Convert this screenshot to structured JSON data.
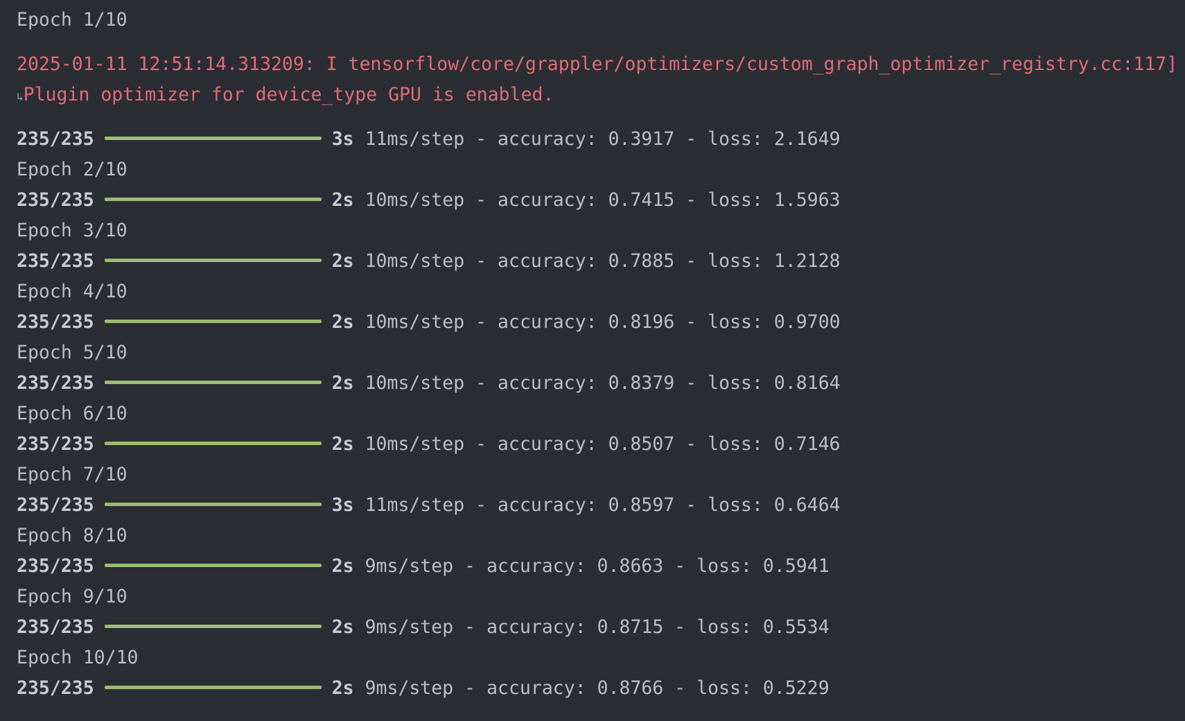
{
  "console": {
    "warning": {
      "line1": "2025-01-11 12:51:14.313209: I tensorflow/core/grappler/optimizers/custom_graph_optimizer_registry.cc:117]",
      "line2": "Plugin optimizer for device_type GPU is enabled.",
      "wrap_icon_start": "wrap-arrow-icon",
      "wrap_icon_end": "wrap-continue-icon"
    },
    "progress_color": "#9bbd72",
    "error_color": "#e06c75",
    "epochs": [
      {
        "label": "Epoch 1/10",
        "steps": "235/235",
        "progress": 1.0,
        "duration": "3s",
        "stats": "11ms/step - accuracy: 0.3917 - loss: 2.1649"
      },
      {
        "label": "Epoch 2/10",
        "steps": "235/235",
        "progress": 1.0,
        "duration": "2s",
        "stats": "10ms/step - accuracy: 0.7415 - loss: 1.5963"
      },
      {
        "label": "Epoch 3/10",
        "steps": "235/235",
        "progress": 1.0,
        "duration": "2s",
        "stats": "10ms/step - accuracy: 0.7885 - loss: 1.2128"
      },
      {
        "label": "Epoch 4/10",
        "steps": "235/235",
        "progress": 1.0,
        "duration": "2s",
        "stats": "10ms/step - accuracy: 0.8196 - loss: 0.9700"
      },
      {
        "label": "Epoch 5/10",
        "steps": "235/235",
        "progress": 1.0,
        "duration": "2s",
        "stats": "10ms/step - accuracy: 0.8379 - loss: 0.8164"
      },
      {
        "label": "Epoch 6/10",
        "steps": "235/235",
        "progress": 1.0,
        "duration": "2s",
        "stats": "10ms/step - accuracy: 0.8507 - loss: 0.7146"
      },
      {
        "label": "Epoch 7/10",
        "steps": "235/235",
        "progress": 1.0,
        "duration": "3s",
        "stats": "11ms/step - accuracy: 0.8597 - loss: 0.6464"
      },
      {
        "label": "Epoch 8/10",
        "steps": "235/235",
        "progress": 1.0,
        "duration": "2s",
        "stats": "9ms/step - accuracy: 0.8663 - loss: 0.5941"
      },
      {
        "label": "Epoch 9/10",
        "steps": "235/235",
        "progress": 1.0,
        "duration": "2s",
        "stats": "9ms/step - accuracy: 0.8715 - loss: 0.5534"
      },
      {
        "label": "Epoch 10/10",
        "steps": "235/235",
        "progress": 1.0,
        "duration": "2s",
        "stats": "9ms/step - accuracy: 0.8766 - loss: 0.5229"
      }
    ]
  }
}
